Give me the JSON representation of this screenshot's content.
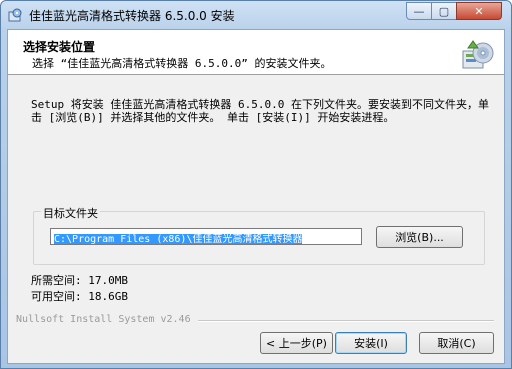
{
  "window": {
    "title": "佳佳蓝光高清格式转换器 6.5.0.0 安装",
    "min_label": "—",
    "max_label": "▢",
    "close_label": "✕"
  },
  "header": {
    "title": "选择安装位置",
    "subtitle": "选择 “佳佳蓝光高清格式转换器 6.5.0.0” 的安装文件夹。"
  },
  "intro": {
    "text": "Setup 将安装 佳佳蓝光高清格式转换器 6.5.0.0 在下列文件夹。要安装到不同文件夹，单击 [浏览(B)] 并选择其他的文件夹。 单击 [安装(I)] 开始安装进程。"
  },
  "destination": {
    "group_label": "目标文件夹",
    "path": "C:\\Program Files (x86)\\佳佳蓝光高清格式转换器",
    "browse_label": "浏览(B)..."
  },
  "space": {
    "required": "所需空间: 17.0MB",
    "available": "可用空间: 18.6GB"
  },
  "branding": "Nullsoft Install System v2.46",
  "buttons": {
    "back": "< 上一步(P)",
    "install": "安装(I)",
    "cancel": "取消(C)"
  }
}
